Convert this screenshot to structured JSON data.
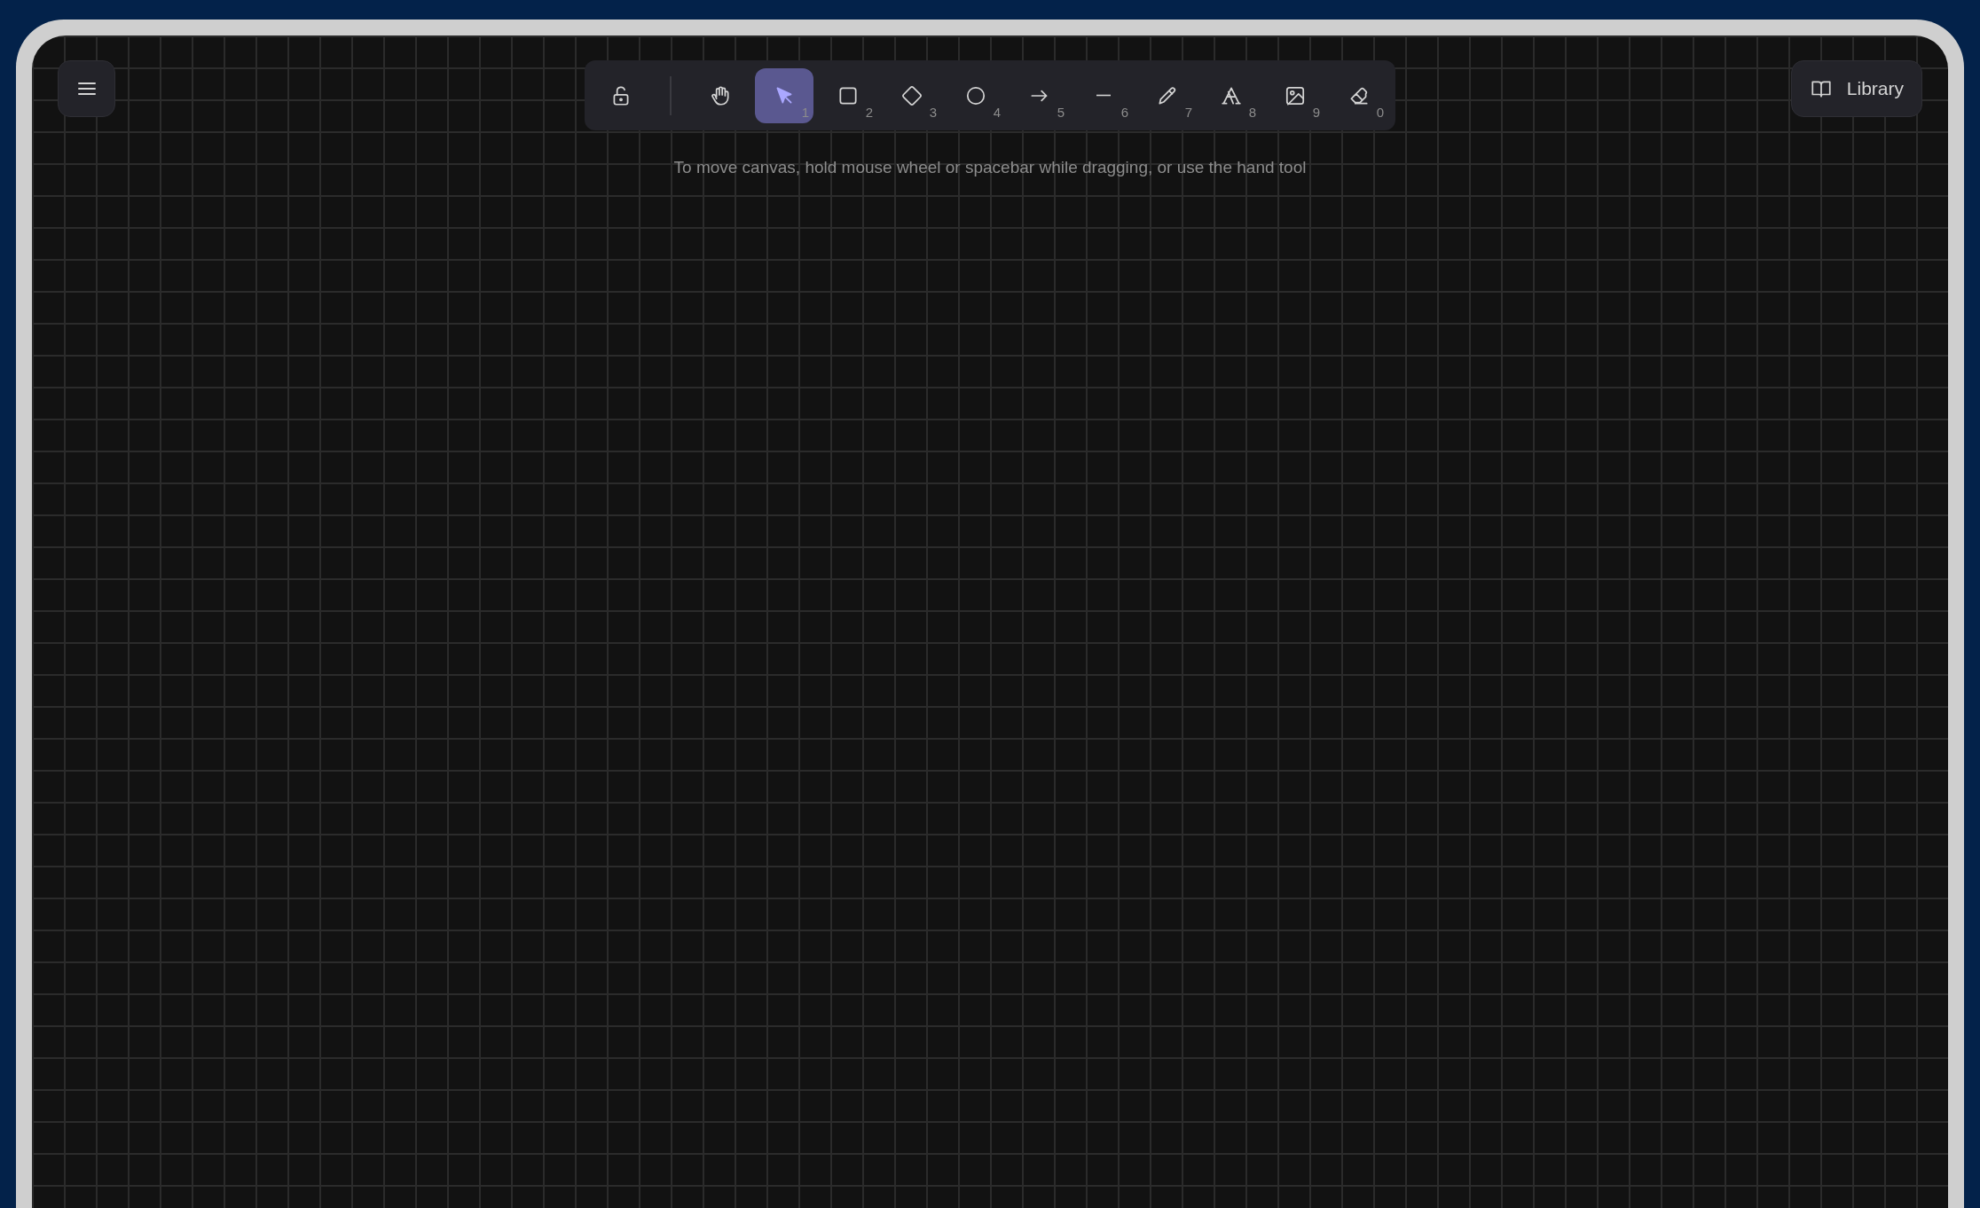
{
  "toolbar": {
    "tools": [
      {
        "selected": false
      },
      {
        "key": "1",
        "selected": true
      },
      {
        "key": "2",
        "selected": false
      },
      {
        "key": "3",
        "selected": false
      },
      {
        "key": "4",
        "selected": false
      },
      {
        "key": "5",
        "selected": false
      },
      {
        "key": "6",
        "selected": false
      },
      {
        "key": "7",
        "selected": false
      },
      {
        "key": "8",
        "selected": false
      },
      {
        "key": "9",
        "selected": false
      },
      {
        "key": "0",
        "selected": false
      }
    ]
  },
  "hint": "To move canvas, hold mouse wheel or spacebar while dragging, or use the hand tool",
  "library_button": {
    "label": "Library"
  }
}
